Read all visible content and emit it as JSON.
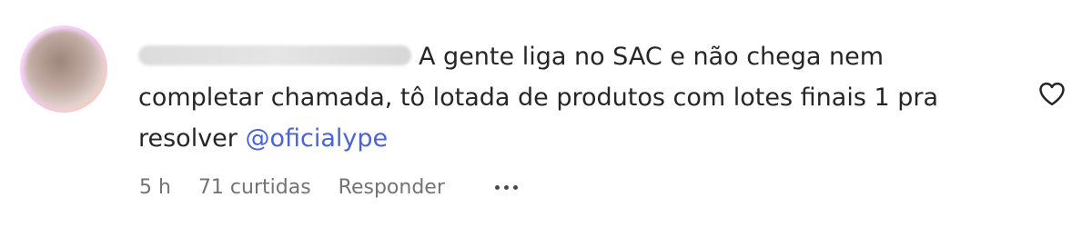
{
  "comment": {
    "username": "",
    "text_line": "A gente liga no SAC e não chega nem completar chamada, tô lotada de produtos com lotes finais 1 pra resolver ",
    "mention": "@oficialype",
    "time": "5 h",
    "likes": "71 curtidas",
    "reply_label": "Responder"
  },
  "icons": {
    "like": "heart-outline-icon",
    "more": "more-options-icon"
  },
  "colors": {
    "mention": "#4a63d6",
    "meta": "#737373",
    "text": "#262626"
  }
}
